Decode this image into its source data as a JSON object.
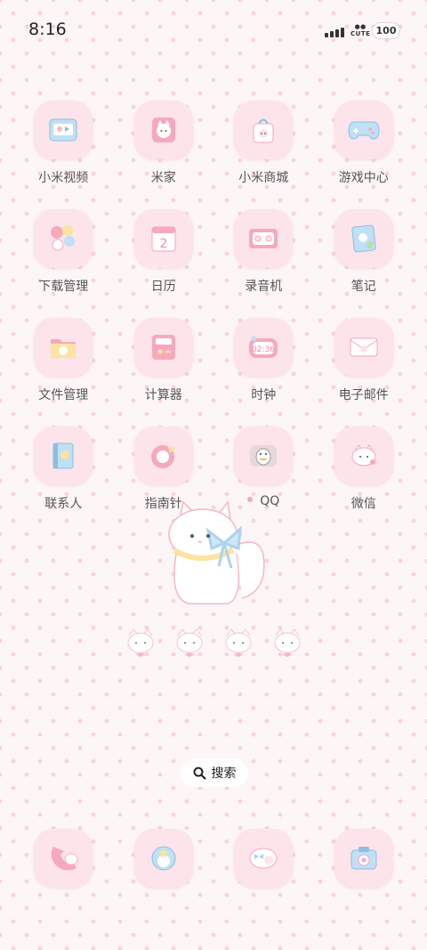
{
  "status_bar": {
    "time": "8:16",
    "carrier_badge": "CUTE",
    "battery": "100"
  },
  "apps": [
    [
      {
        "label": "小米视频",
        "icon": "video-icon"
      },
      {
        "label": "米家",
        "icon": "home-icon"
      },
      {
        "label": "小米商城",
        "icon": "store-bag-icon"
      },
      {
        "label": "游戏中心",
        "icon": "gamepad-icon"
      }
    ],
    [
      {
        "label": "下载管理",
        "icon": "balloons-icon"
      },
      {
        "label": "日历",
        "icon": "calendar-icon",
        "calendar_day": "2"
      },
      {
        "label": "录音机",
        "icon": "recorder-icon"
      },
      {
        "label": "笔记",
        "icon": "notebook-icon"
      }
    ],
    [
      {
        "label": "文件管理",
        "icon": "folder-icon"
      },
      {
        "label": "计算器",
        "icon": "calculator-icon"
      },
      {
        "label": "时钟",
        "icon": "clock-icon",
        "clock_time": "02:36"
      },
      {
        "label": "电子邮件",
        "icon": "envelope-icon"
      }
    ],
    [
      {
        "label": "联系人",
        "icon": "contacts-book-icon"
      },
      {
        "label": "指南针",
        "icon": "compass-icon"
      },
      {
        "label": "QQ",
        "icon": "penguin-icon",
        "notification_dot": true
      },
      {
        "label": "微信",
        "icon": "cat-chat-icon"
      }
    ]
  ],
  "search": {
    "label": "搜索"
  },
  "dock": [
    {
      "icon": "phone-icon"
    },
    {
      "icon": "browser-globe-icon"
    },
    {
      "icon": "messages-icon"
    },
    {
      "icon": "camera-icon"
    }
  ],
  "colors": {
    "tile": "#fde3ea",
    "accent_pink": "#f4a6bb",
    "accent_blue": "#a9d4f0",
    "background": "#fdf6f7"
  }
}
